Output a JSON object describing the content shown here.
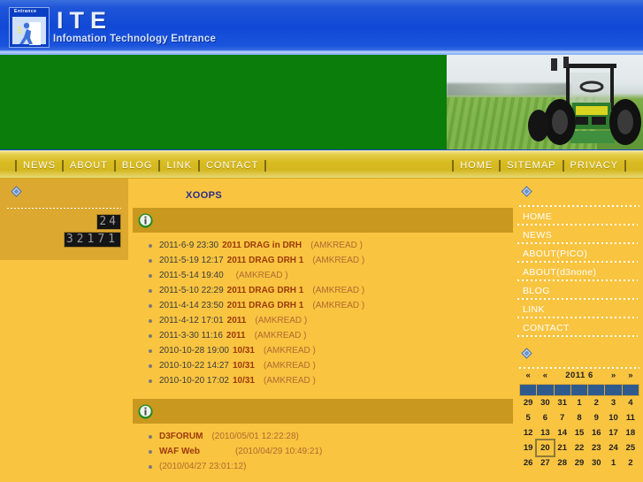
{
  "site": {
    "logo_badge_text": "Entrance",
    "brand": "ITE",
    "tagline": "Infomation Technology Entrance"
  },
  "nav": {
    "left_items": [
      {
        "label": "NEWS"
      },
      {
        "label": "ABOUT"
      },
      {
        "label": "BLOG"
      },
      {
        "label": "LINK"
      },
      {
        "label": "CONTACT"
      }
    ],
    "right_items": [
      {
        "label": "HOME"
      },
      {
        "label": "SITEMAP"
      },
      {
        "label": "PRIVACY"
      }
    ]
  },
  "left_column": {
    "block_icon": "diamond-bullet-icon",
    "counter": {
      "today_label": ":",
      "today_value": "24",
      "total_label": ":",
      "total_value": "32171"
    }
  },
  "center": {
    "page_title": "XOOPS",
    "panel_news": {
      "icon": "info-icon",
      "title": ""
    },
    "news_items": [
      {
        "date": "2011-6-9 23:30",
        "title": "2011 DRAG in  DRH",
        "meta": "(AMKREAD   )"
      },
      {
        "date": "2011-5-19 12:17",
        "title": "2011 DRAG    DRH 1",
        "meta": "(AMKREAD   )"
      },
      {
        "date": "2011-5-14 19:40",
        "title": "",
        "meta": "(AMKREAD   )"
      },
      {
        "date": "2011-5-10 22:29",
        "title": "2011 DRAG     DRH 1",
        "meta": "(AMKREAD   )"
      },
      {
        "date": "2011-4-14 23:50",
        "title": "2011 DRAG    DRH 1",
        "meta": "(AMKREAD   )"
      },
      {
        "date": "2011-4-12 17:01",
        "title": "2011",
        "meta": "(AMKREAD   )"
      },
      {
        "date": "2011-3-30 11:16",
        "title": "2011",
        "meta": "(AMKREAD   )"
      },
      {
        "date": "2010-10-28 19:00",
        "title": "10/31",
        "meta": "(AMKREAD   )"
      },
      {
        "date": "2010-10-22 14:27",
        "title": "10/31",
        "meta": "(AMKREAD   )"
      },
      {
        "date": "2010-10-20 17:02",
        "title": "10/31",
        "meta": "(AMKREAD   )"
      }
    ],
    "panel_recent": {
      "icon": "info-icon",
      "title": ""
    },
    "recent_items": [
      {
        "title": "D3FORUM",
        "meta": "(2010/05/01 12:22:28)"
      },
      {
        "title": "WAF Web",
        "meta": "(2010/04/29 10:49:21)"
      },
      {
        "title": "",
        "meta": "(2010/04/27 23:01:12)"
      }
    ]
  },
  "right_column": {
    "menu_icon": "diamond-bullet-icon",
    "menu": [
      {
        "label": "HOME"
      },
      {
        "label": "NEWS"
      },
      {
        "label": "ABOUT(PICO)"
      },
      {
        "label": "ABOUT(d3none)"
      },
      {
        "label": "BLOG"
      },
      {
        "label": "LINK"
      },
      {
        "label": "CONTACT"
      }
    ],
    "calendar": {
      "icon": "diamond-bullet-icon",
      "prev_year": "«",
      "prev_month": "«",
      "month_label": "2011 6",
      "next_month": "»",
      "next_year": "»",
      "dow": [
        "",
        "",
        "",
        "",
        "",
        "",
        ""
      ],
      "weeks": [
        [
          {
            "d": "29",
            "out": true
          },
          {
            "d": "30",
            "out": true
          },
          {
            "d": "31",
            "out": true
          },
          {
            "d": "1"
          },
          {
            "d": "2"
          },
          {
            "d": "3"
          },
          {
            "d": "4"
          }
        ],
        [
          {
            "d": "5"
          },
          {
            "d": "6"
          },
          {
            "d": "7"
          },
          {
            "d": "8"
          },
          {
            "d": "9"
          },
          {
            "d": "10"
          },
          {
            "d": "11"
          }
        ],
        [
          {
            "d": "12"
          },
          {
            "d": "13"
          },
          {
            "d": "14"
          },
          {
            "d": "15"
          },
          {
            "d": "16"
          },
          {
            "d": "17"
          },
          {
            "d": "18"
          }
        ],
        [
          {
            "d": "19"
          },
          {
            "d": "20",
            "today": true
          },
          {
            "d": "21"
          },
          {
            "d": "22"
          },
          {
            "d": "23"
          },
          {
            "d": "24"
          },
          {
            "d": "25"
          }
        ],
        [
          {
            "d": "26"
          },
          {
            "d": "27"
          },
          {
            "d": "28"
          },
          {
            "d": "29"
          },
          {
            "d": "30"
          },
          {
            "d": "1",
            "out": true
          },
          {
            "d": "2",
            "out": true
          }
        ]
      ]
    }
  },
  "colors": {
    "header_blue": "#1149d6",
    "banner_green": "#0a7d0a",
    "nav_gold": "#d8bc22",
    "page_bg": "#f9c440",
    "block_bg": "#dda82f",
    "panel_head": "#c8981f",
    "link_red": "#9c3a0c",
    "title_navy": "#2a2a8c",
    "dow_blue": "#2f5a8e"
  }
}
